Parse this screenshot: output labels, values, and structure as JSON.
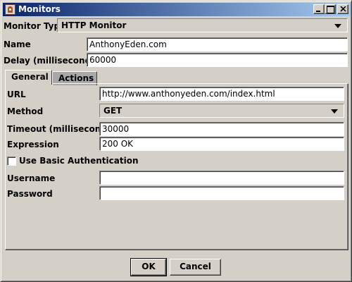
{
  "window": {
    "title": "Monitors"
  },
  "monitor_type": {
    "label": "Monitor Type",
    "value": "HTTP Monitor"
  },
  "name": {
    "label": "Name",
    "value": "AnthonyEden.com"
  },
  "delay": {
    "label": "Delay (milliseconds)",
    "value": "60000"
  },
  "tabs": [
    {
      "label": "General",
      "selected": true
    },
    {
      "label": "Actions",
      "selected": false
    }
  ],
  "general": {
    "url_label": "URL",
    "url_value": "http://www.anthonyeden.com/index.html",
    "method_label": "Method",
    "method_value": "GET",
    "timeout_label": "Timeout (milliseconds)",
    "timeout_value": "30000",
    "expression_label": "Expression",
    "expression_value": "200 OK",
    "basic_auth_label": "Use Basic Authentication",
    "basic_auth_checked": false,
    "username_label": "Username",
    "username_value": "",
    "password_label": "Password",
    "password_value": ""
  },
  "buttons": {
    "ok_label": "OK",
    "cancel_label": "Cancel"
  },
  "colors": {
    "title_start": "#0a246a",
    "title_end": "#a6caf0",
    "face": "#d4d0c8"
  }
}
